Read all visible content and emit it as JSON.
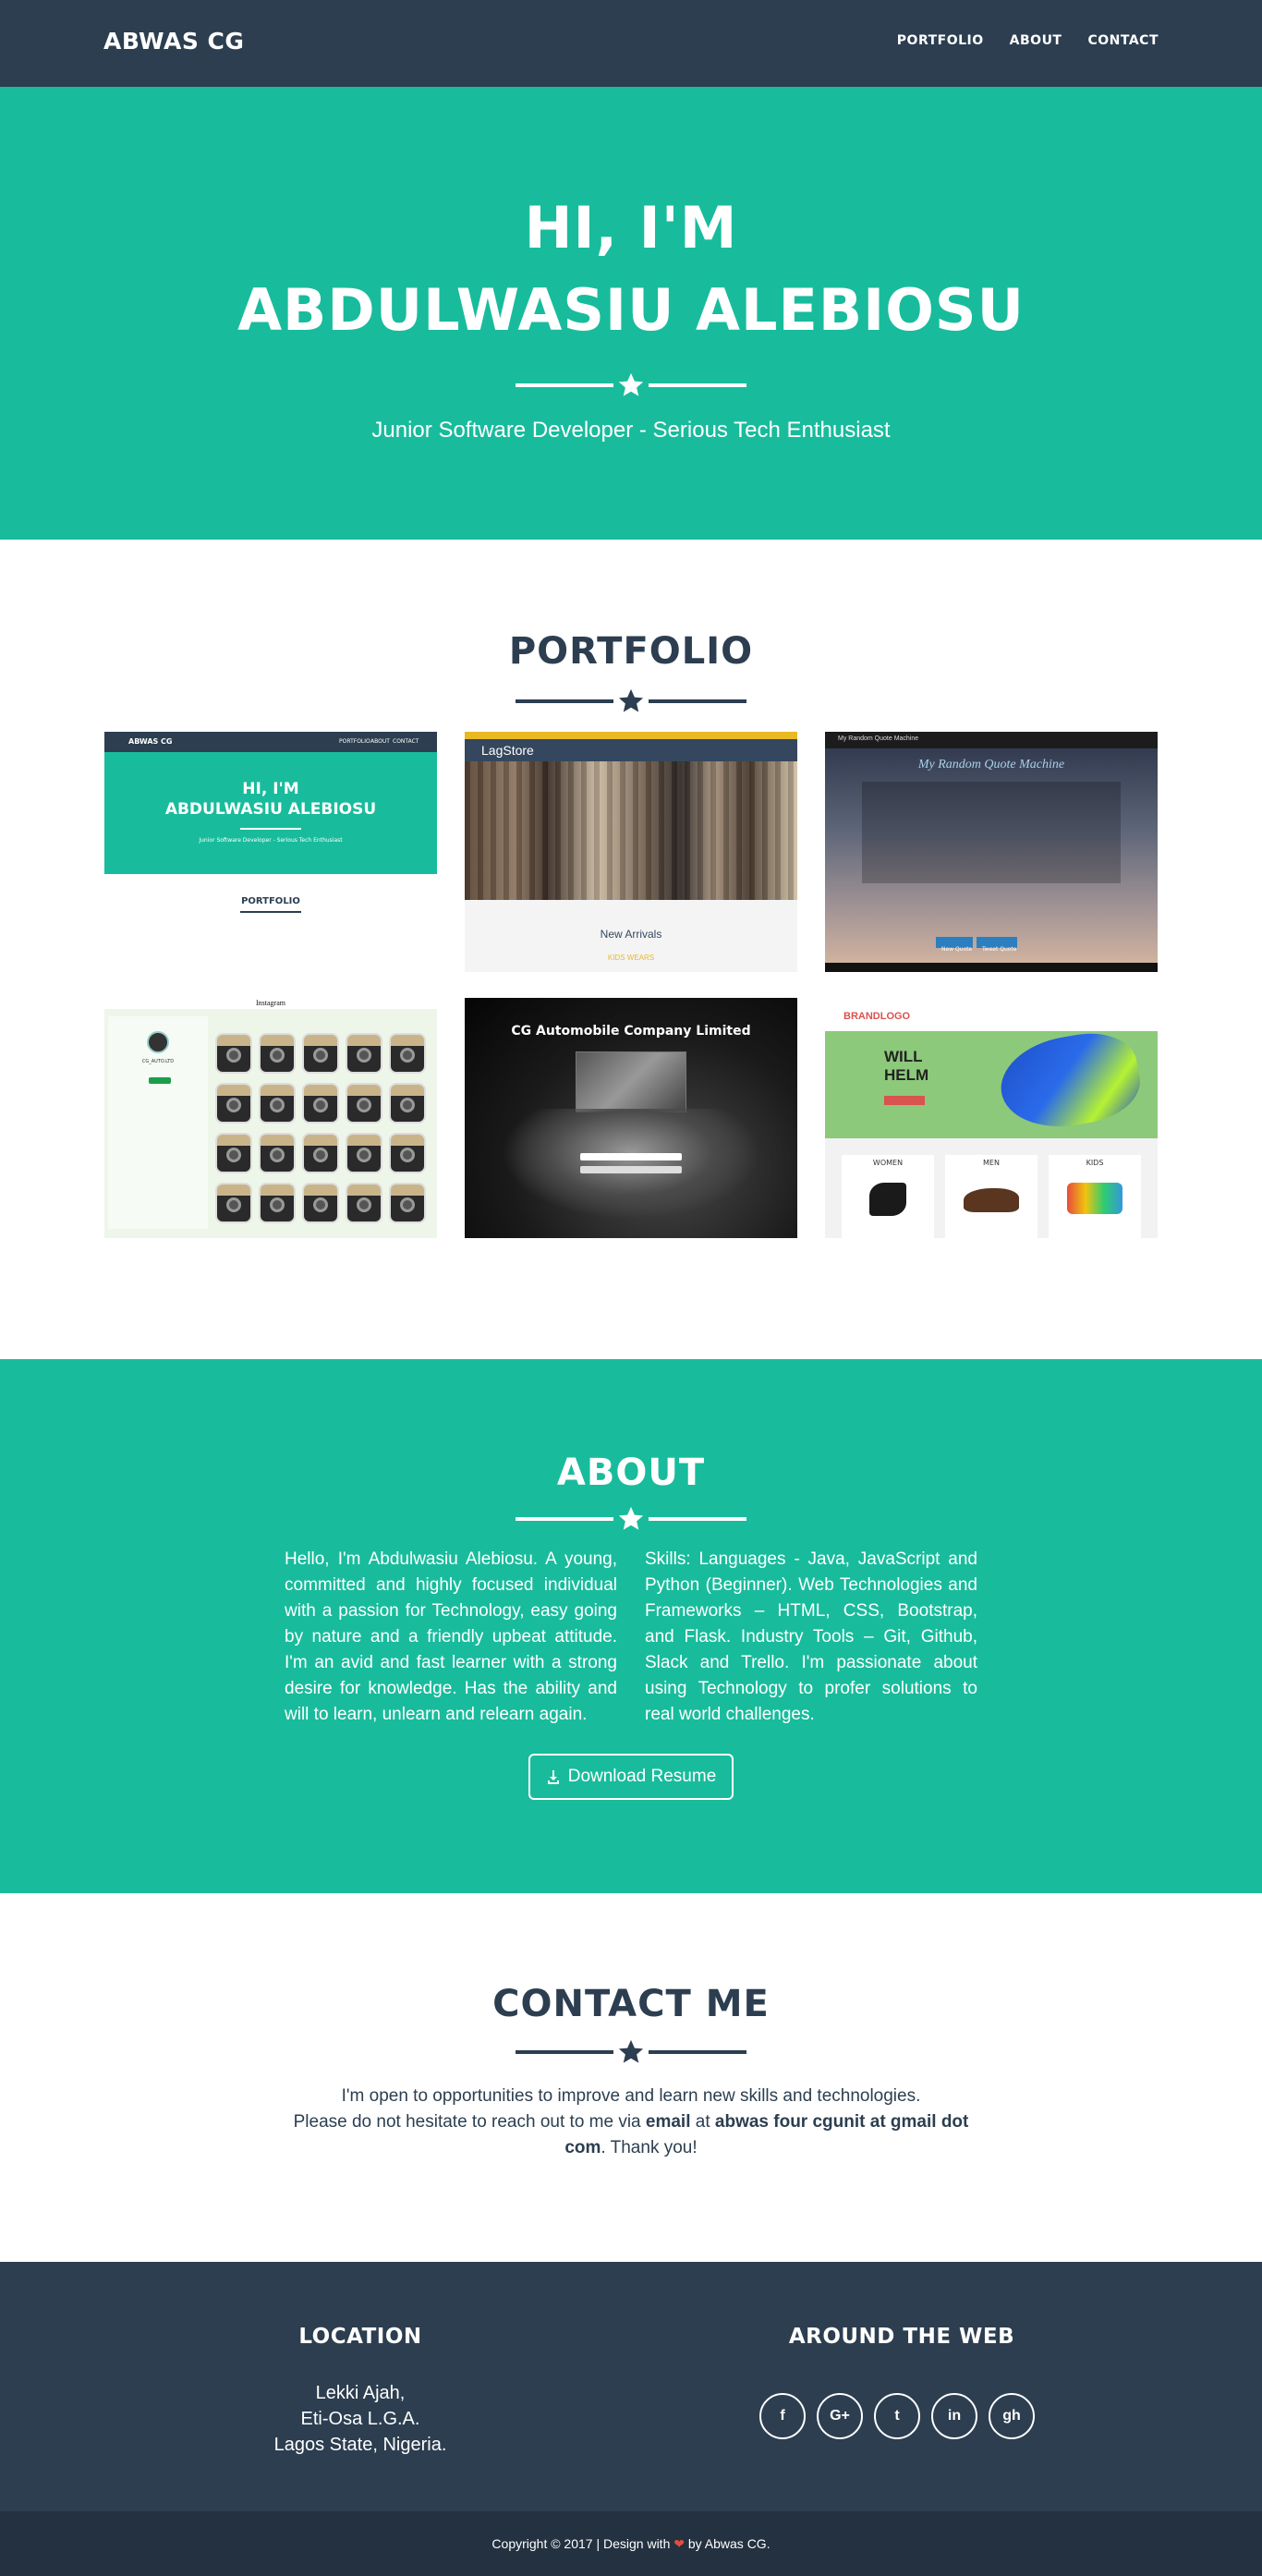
{
  "nav": {
    "brand": "ABWAS CG",
    "links": [
      "PORTFOLIO",
      "ABOUT",
      "CONTACT"
    ]
  },
  "hero": {
    "line1": "HI, I'M",
    "line2": "ABDULWASIU ALEBIOSU",
    "tagline": "Junior Software Developer - Serious Tech Enthusiast"
  },
  "portfolio": {
    "title": "PORTFOLIO",
    "items": [
      {
        "brand": "ABWAS CG",
        "nav": [
          "PORTFOLIO",
          "ABOUT",
          "CONTACT"
        ],
        "line1": "HI, I'M",
        "line2": "ABDULWASIU ALEBIOSU",
        "tagline": "Junior Software Developer - Serious Tech Enthusiast",
        "section": "PORTFOLIO"
      },
      {
        "logo": "LagStore",
        "caption": "New Arrivals",
        "sub": "KIDS WEARS"
      },
      {
        "tab": "My Random Quote Machine",
        "title": "My Random Quote Machine",
        "buttons": [
          "New Quote",
          "Tweet Quote"
        ]
      },
      {
        "title": "Instagram",
        "user": "CG_AUTO.LTD"
      },
      {
        "title": "CG Automobile Company Limited"
      },
      {
        "logo": "BRANDLOGO",
        "banner1": "WILL",
        "banner2": "HELM",
        "labels": [
          "WOMEN",
          "MEN",
          "KIDS"
        ]
      }
    ]
  },
  "about": {
    "title": "ABOUT",
    "left": "Hello, I'm Abdulwasiu Alebiosu. A young, committed and highly focused individual with a passion for Technology, easy going by nature and a friendly upbeat attitude. I'm an avid and fast learner with a strong desire for knowledge. Has the ability and will to learn, unlearn and relearn again.",
    "right": "Skills: Languages - Java, JavaScript and Python (Beginner). Web Technologies and Frameworks – HTML, CSS, Bootstrap, and Flask. Industry Tools – Git, Github, Slack and Trello. I'm passionate about using Technology to profer solutions to real world challenges.",
    "button": "Download Resume"
  },
  "contact": {
    "title": "CONTACT ME",
    "line1": "I'm open to opportunities to improve and learn new skills and technologies.",
    "line2_pre": "Please do not hesitate to reach out to me via ",
    "email_word": "email",
    "at": " at ",
    "address": "abwas four cgunit at gmail dot com",
    "thanks": ". Thank you!"
  },
  "footer": {
    "location_title": "LOCATION",
    "address_lines": [
      "Lekki Ajah,",
      "Eti-Osa L.G.A.",
      "Lagos State, Nigeria."
    ],
    "web_title": "AROUND THE WEB",
    "social": [
      "f",
      "G+",
      "t",
      "in",
      "gh"
    ],
    "copy_pre": "Copyright © 2017 | Design with ",
    "heart": "❤",
    "copy_post": " by Abwas CG."
  },
  "colors": {
    "primary": "#2c3e50",
    "accent": "#18bc9c",
    "heart": "#e74c3c"
  }
}
